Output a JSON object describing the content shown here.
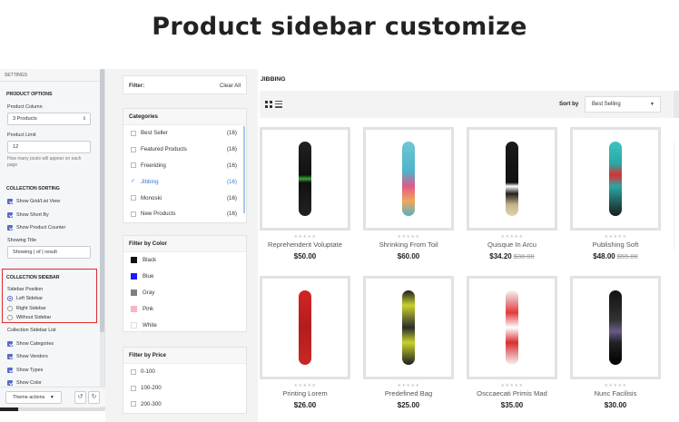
{
  "headline": "Product sidebar customize",
  "settings": {
    "title": "SETTINGS",
    "product_options": {
      "heading": "PRODUCT OPTIONS",
      "column_label": "Product Column",
      "column_value": "3 Products",
      "limit_label": "Product Limit",
      "limit_value": "12",
      "limit_help": "How many posts will appear on each page"
    },
    "collection_sorting": {
      "heading": "COLLECTION SORTING",
      "options": [
        "Show Grid/List View",
        "Show Short By",
        "Show Product Counter"
      ],
      "showing_title_label": "Showing Title",
      "showing_title_value": "Showing | of | result"
    },
    "collection_sidebar": {
      "heading": "COLLECTION SIDEBAR",
      "position_label": "Sidebar Position",
      "positions": [
        "Left Sidebar",
        "Right Sidebar",
        "Without Sidebar"
      ],
      "selected_position": "Left Sidebar"
    },
    "sidebar_list": {
      "label": "Collection Sidebar List",
      "options": [
        "Show Categories",
        "Show Vendors",
        "Show Types",
        "Show Color"
      ]
    },
    "footer": {
      "theme_actions": "Theme actions",
      "undo_icon": "undo-icon",
      "redo_icon": "redo-icon"
    }
  },
  "filters": {
    "filter_label": "Filter:",
    "clear_all": "Clear All",
    "categories": {
      "heading": "Categories",
      "items": [
        {
          "name": "Best Seller",
          "count": "(16)",
          "active": false
        },
        {
          "name": "Featured Products",
          "count": "(16)",
          "active": false
        },
        {
          "name": "Freeriding",
          "count": "(16)",
          "active": false
        },
        {
          "name": "Jibbing",
          "count": "(16)",
          "active": true
        },
        {
          "name": "Monoski",
          "count": "(16)",
          "active": false
        },
        {
          "name": "New Products",
          "count": "(16)",
          "active": false
        }
      ]
    },
    "colors": {
      "heading": "Filter by Color",
      "items": [
        {
          "name": "Black",
          "color": "#111111"
        },
        {
          "name": "Blue",
          "color": "#1a1aff"
        },
        {
          "name": "Gray",
          "color": "#808080"
        },
        {
          "name": "Pink",
          "color": "#f7b6c0"
        },
        {
          "name": "White",
          "color": "#ffffff"
        }
      ]
    },
    "price": {
      "heading": "Filter by Price",
      "items": [
        "0-100",
        "100-200",
        "200-300"
      ]
    }
  },
  "main": {
    "breadcrumb": "JIBBING",
    "sort_label": "Sort by",
    "sort_value": "Best Selling",
    "products": [
      {
        "name": "Reprehenderit Voluptate",
        "price": "$50.00",
        "old_price": "",
        "board": "black-green"
      },
      {
        "name": "Shrinking From Toil",
        "price": "$60.00",
        "old_price": "",
        "board": "cyan-pink"
      },
      {
        "name": "Quisque In Arcu",
        "price": "$34.20",
        "old_price": "$38.00",
        "board": "black-beige"
      },
      {
        "name": "Publishing Soft",
        "price": "$48.00",
        "old_price": "$55.00",
        "board": "teal-red"
      },
      {
        "name": "Printing Lorem",
        "price": "$26.00",
        "old_price": "",
        "board": "red-arbor"
      },
      {
        "name": "Predefined Bag",
        "price": "$25.00",
        "old_price": "",
        "board": "black-yellow"
      },
      {
        "name": "Osccaecati Primis Mad",
        "price": "$35.00",
        "old_price": "",
        "board": "white-red"
      },
      {
        "name": "Nunc Facilisis",
        "price": "$30.00",
        "old_price": "",
        "board": "black-dark"
      }
    ],
    "rating_stars": "★★★★★"
  },
  "colors": {
    "accent": "#5b6ac4",
    "highlight": "#e02b2b",
    "active_link": "#3a7bd5"
  }
}
